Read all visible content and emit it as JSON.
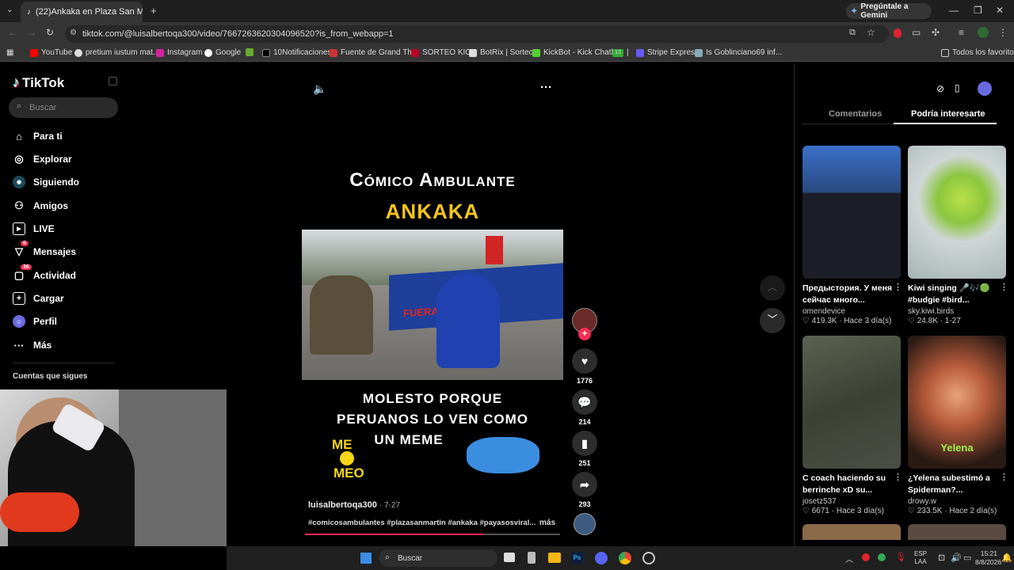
{
  "browser": {
    "tab_title": "(22)Ankaka en Plaza San M",
    "url": "tiktok.com/@luisalbertoqa300/video/7667263620304096520?is_from_webapp=1",
    "gemini_label": "Pregúntale a Gemini",
    "bookmarks": [
      "YouTube",
      "pretium iustum mat...",
      "Instagram",
      "Google",
      "10Notificaciones",
      "Fuente de Grand Th...",
      "SORTEO KICK",
      "BotRix | Sorteos",
      "KickBot - Kick Chatb...",
      "Stripe Express",
      "Is Goblinciano69 inf..."
    ],
    "all_favorites": "Todos los favoritos",
    "bm_badge": "13"
  },
  "sidebar": {
    "logo": "TikTok",
    "search_placeholder": "Buscar",
    "items": [
      {
        "label": "Para ti",
        "icon": "home-icon"
      },
      {
        "label": "Explorar",
        "icon": "compass-icon"
      },
      {
        "label": "Siguiendo",
        "icon": "following-icon"
      },
      {
        "label": "Amigos",
        "icon": "friends-icon"
      },
      {
        "label": "LIVE",
        "icon": "live-icon"
      },
      {
        "label": "Mensajes",
        "icon": "messages-icon",
        "badge": "6"
      },
      {
        "label": "Actividad",
        "icon": "activity-icon",
        "badge": "36"
      },
      {
        "label": "Cargar",
        "icon": "upload-icon"
      },
      {
        "label": "Perfil",
        "icon": "profile-icon"
      },
      {
        "label": "Más",
        "icon": "more-icon"
      }
    ],
    "following_heading": "Cuentas que sigues"
  },
  "video": {
    "title_line1": "Cómico Ambulante",
    "title_line2": "ANKAKA",
    "clip_banner": "FUERA",
    "caption_line1": "MOLESTO PORQUE",
    "caption_line2": "PERUANOS LO VEN COMO",
    "caption_line3": "UN MEME",
    "sticker_top": "ME",
    "sticker_bottom": "MEO",
    "author": "luisalbertoqa300",
    "date": "· 7-27",
    "hashtags": "#comicosambulantes #plazasanmartin #ankaka #payasosviral...",
    "more": "más",
    "likes": "1776",
    "comments": "214",
    "saves": "251",
    "shares": "293"
  },
  "right_panel": {
    "tabs": [
      "Comentarios",
      "Podría interesarte"
    ],
    "active_tab": 1,
    "cards": [
      {
        "title": "Предыстория. У меня сейчас много...",
        "author": "omendevice",
        "stats": "♡ 419.3K · Hace 3 día(s)"
      },
      {
        "title": "Kiwi singing 🎤🎶🟢 #budgie #bird...",
        "author": "sky.kiwi.birds",
        "stats": "♡ 24.8K · 1-27"
      },
      {
        "title": "C coach haciendo su berrinche xD su...",
        "author": "josetz537",
        "stats": "♡ 6671 · Hace 3 día(s)"
      },
      {
        "title": "¿Yelena subestimó a Spiderman?...",
        "author": "drowy.w",
        "stats": "♡ 233.5K · Hace 2 día(s)"
      }
    ],
    "yelena_overlay": "Yelena"
  },
  "taskbar": {
    "search": "Buscar",
    "lang_top": "ESP",
    "lang_bottom": "LAA",
    "time": "15:21",
    "date": "8/8/2026"
  }
}
